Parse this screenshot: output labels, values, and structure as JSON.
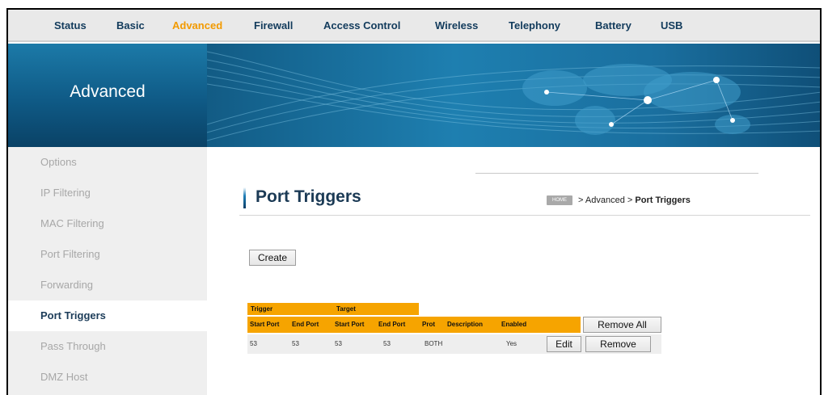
{
  "nav": {
    "items": [
      {
        "label": "Status",
        "active": false
      },
      {
        "label": "Basic",
        "active": false
      },
      {
        "label": "Advanced",
        "active": true
      },
      {
        "label": "Firewall",
        "active": false
      },
      {
        "label": "Access Control",
        "active": false
      },
      {
        "label": "Wireless",
        "active": false
      },
      {
        "label": "Telephony",
        "active": false
      },
      {
        "label": "Battery",
        "active": false
      },
      {
        "label": "USB",
        "active": false
      }
    ]
  },
  "banner": {
    "title": "Advanced"
  },
  "sidebar": {
    "items": [
      {
        "label": "Options"
      },
      {
        "label": "IP Filtering"
      },
      {
        "label": "MAC Filtering"
      },
      {
        "label": "Port Filtering"
      },
      {
        "label": "Forwarding"
      },
      {
        "label": "Port Triggers"
      },
      {
        "label": "Pass Through"
      },
      {
        "label": "DMZ Host"
      }
    ],
    "active_index": 5
  },
  "page": {
    "title": "Port Triggers",
    "breadcrumb_home": "HOME",
    "breadcrumb_text": " > Advanced > ",
    "breadcrumb_current": "Port Triggers"
  },
  "create_button": "Create",
  "table": {
    "group_headers": {
      "trigger": "Trigger",
      "target": "Target"
    },
    "columns": [
      "Start Port",
      "End Port",
      "Start Port",
      "End Port",
      "Prot",
      "Description",
      "Enabled"
    ],
    "remove_all_label": "Remove All",
    "rows": [
      {
        "trigger_start": "53",
        "trigger_end": "53",
        "target_start": "53",
        "target_end": "53",
        "prot": "BOTH",
        "description": "",
        "enabled": "Yes",
        "edit_label": "Edit",
        "remove_label": "Remove"
      }
    ]
  },
  "colors": {
    "accent_orange": "#f6a400",
    "nav_active": "#f29a00",
    "nav_text": "#123b5c",
    "banner_blue": "#1e7fb0"
  }
}
